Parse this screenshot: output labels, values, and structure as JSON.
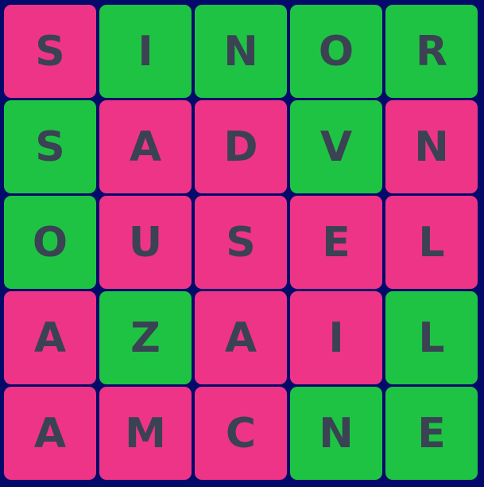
{
  "colors": {
    "background": "#030a6a",
    "pink": "#ee3487",
    "green": "#1fc343",
    "letter": "#3a4253"
  },
  "rows": [
    [
      {
        "letter": "S",
        "color": "pink"
      },
      {
        "letter": "I",
        "color": "green"
      },
      {
        "letter": "N",
        "color": "green"
      },
      {
        "letter": "O",
        "color": "green"
      },
      {
        "letter": "R",
        "color": "green"
      }
    ],
    [
      {
        "letter": "S",
        "color": "green"
      },
      {
        "letter": "A",
        "color": "pink"
      },
      {
        "letter": "D",
        "color": "pink"
      },
      {
        "letter": "V",
        "color": "green"
      },
      {
        "letter": "N",
        "color": "pink"
      }
    ],
    [
      {
        "letter": "O",
        "color": "green"
      },
      {
        "letter": "U",
        "color": "pink"
      },
      {
        "letter": "S",
        "color": "pink"
      },
      {
        "letter": "E",
        "color": "pink"
      },
      {
        "letter": "L",
        "color": "pink"
      }
    ],
    [
      {
        "letter": "A",
        "color": "pink"
      },
      {
        "letter": "Z",
        "color": "green"
      },
      {
        "letter": "A",
        "color": "pink"
      },
      {
        "letter": "I",
        "color": "pink"
      },
      {
        "letter": "L",
        "color": "green"
      }
    ],
    [
      {
        "letter": "A",
        "color": "pink"
      },
      {
        "letter": "M",
        "color": "pink"
      },
      {
        "letter": "C",
        "color": "pink"
      },
      {
        "letter": "N",
        "color": "green"
      },
      {
        "letter": "E",
        "color": "green"
      }
    ]
  ]
}
